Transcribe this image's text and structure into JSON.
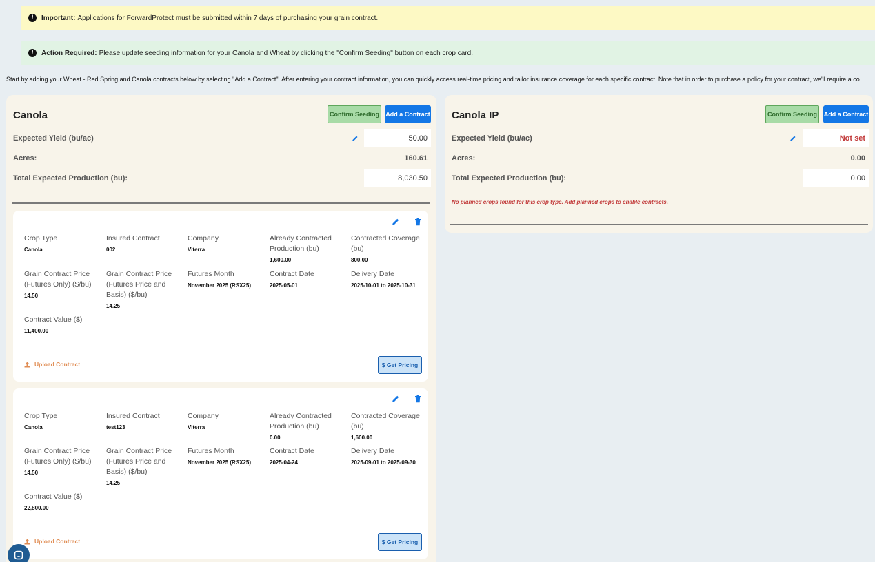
{
  "banners": {
    "important_label": "Important:",
    "important_text": "Applications for ForwardProtect must be submitted within 7 days of purchasing your grain contract.",
    "action_label": "Action Required:",
    "action_text": "Please update seeding information for your Canola and Wheat by clicking the \"Confirm Seeding\" button on each crop card."
  },
  "intro": "Start by adding your Wheat - Red Spring and Canola contracts below by selecting \"Add a Contract\". After entering your contract information, you can quickly access real-time pricing and tailor insurance coverage for each specific contract. Note that in order to purchase a policy for your contract, we'll require a co",
  "buttons": {
    "confirm_seeding": "Confirm Seeding",
    "add_contract": "Add a Contract",
    "upload_contract": "Upload Contract",
    "get_pricing": "$ Get Pricing"
  },
  "labels": {
    "expected_yield": "Expected Yield (bu/ac)",
    "acres": "Acres:",
    "total_production": "Total Expected Production (bu):"
  },
  "left_panel": {
    "title": "Canola",
    "expected_yield": "50.00",
    "acres": "160.61",
    "total_production": "8,030.50"
  },
  "right_panel": {
    "title": "Canola IP",
    "expected_yield": "Not set",
    "acres": "0.00",
    "total_production": "0.00",
    "warning": "No planned crops found for this crop type. Add planned crops to enable contracts."
  },
  "field_labels": {
    "crop_type": "Crop Type",
    "insured_contract": "Insured Contract",
    "company": "Company",
    "already_contracted": "Already Contracted Production (bu)",
    "contracted_coverage": "Contracted Coverage (bu)",
    "futures_price": "Grain Contract Price (Futures Only) ($/bu)",
    "basis_price": "Grain Contract Price (Futures Price and Basis) ($/bu)",
    "futures_month": "Futures Month",
    "contract_date": "Contract Date",
    "delivery_date": "Delivery Date",
    "contract_value": "Contract Value ($)"
  },
  "contracts": [
    {
      "crop_type": "Canola",
      "insured_contract": "002",
      "company": "Viterra",
      "already_contracted": "1,600.00",
      "contracted_coverage": "800.00",
      "futures_price": "14.50",
      "basis_price": "14.25",
      "futures_month": "November 2025 (RSX25)",
      "contract_date": "2025-05-01",
      "delivery_date": "2025-10-01 to 2025-10-31",
      "contract_value": "11,400.00"
    },
    {
      "crop_type": "Canola",
      "insured_contract": "test123",
      "company": "Viterra",
      "already_contracted": "0.00",
      "contracted_coverage": "1,600.00",
      "futures_price": "14.50",
      "basis_price": "14.25",
      "futures_month": "November 2025 (RSX25)",
      "contract_date": "2025-04-24",
      "delivery_date": "2025-09-01 to 2025-09-30",
      "contract_value": "22,800.00"
    }
  ],
  "colors": {
    "primary": "#1477e6",
    "confirm_green": "#a8dba7",
    "warning_red": "#c23b3b",
    "upload_orange": "#e08d54"
  }
}
